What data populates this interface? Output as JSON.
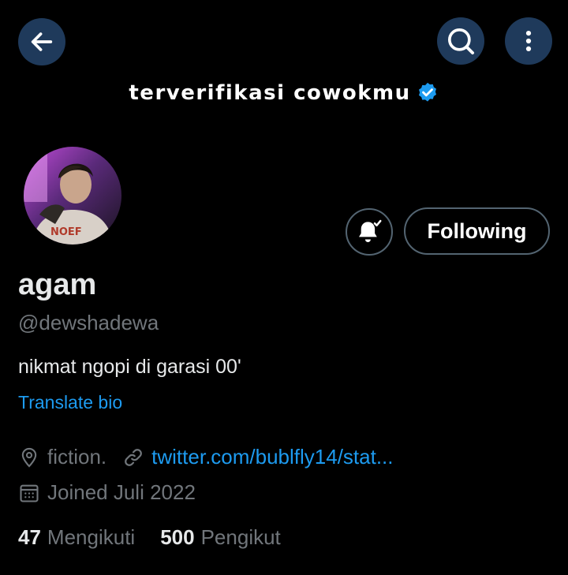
{
  "header": {
    "back_icon": "arrow-left-icon",
    "search_icon": "search-icon",
    "more_icon": "more-vertical-icon",
    "accent": "#1f3a5b"
  },
  "banner": {
    "text": "terverifikasi cowokmu",
    "badge_icon": "verified-badge-icon",
    "badge_color": "#1d9bf0"
  },
  "profile": {
    "display_name": "agam",
    "handle": "@dewshadewa",
    "bio": "nikmat ngopi di garasi 00'",
    "translate_label": "Translate bio",
    "location": "fiction.",
    "website": "twitter.com/bublfly14/stat...",
    "joined": "Joined Juli 2022"
  },
  "actions": {
    "notify_icon": "bell-check-icon",
    "follow_label": "Following"
  },
  "stats": {
    "following_count": "47",
    "following_label": "Mengikuti",
    "followers_count": "500",
    "followers_label": "Pengikut"
  },
  "colors": {
    "background": "#000000",
    "link": "#1d9bf0",
    "muted": "#71767b"
  }
}
